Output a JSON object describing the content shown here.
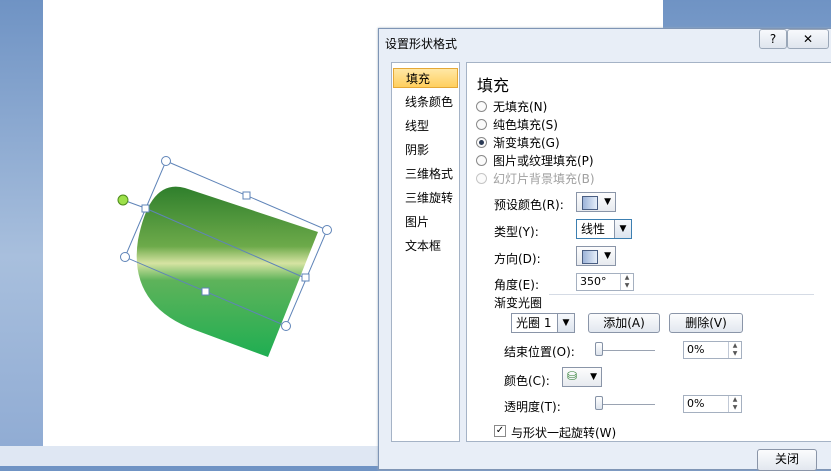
{
  "dialog": {
    "title": "设置形状格式",
    "help_label": "?",
    "close_label": "✕",
    "footer_close_label": "关闭"
  },
  "nav": {
    "items": [
      {
        "label": "填充",
        "active": true
      },
      {
        "label": "线条颜色"
      },
      {
        "label": "线型"
      },
      {
        "label": "阴影"
      },
      {
        "label": "三维格式"
      },
      {
        "label": "三维旋转"
      },
      {
        "label": "图片"
      },
      {
        "label": "文本框"
      }
    ]
  },
  "fill": {
    "title": "填充",
    "options": [
      {
        "label": "无填充(N)"
      },
      {
        "label": "纯色填充(S)"
      },
      {
        "label": "渐变填充(G)",
        "checked": true
      },
      {
        "label": "图片或纹理填充(P)"
      },
      {
        "label": "幻灯片背景填充(B)",
        "disabled": true
      }
    ],
    "preset_label": "预设颜色(R):",
    "type_label": "类型(Y):",
    "type_value": "线性",
    "direction_label": "方向(D):",
    "angle_label": "角度(E):",
    "angle_value": "350°",
    "stops_label": "渐变光圈",
    "stop_select_value": "光圈 1",
    "add_label": "添加(A)",
    "delete_label": "删除(V)",
    "end_position_label": "结束位置(O):",
    "end_position_value": "0%",
    "color_label": "颜色(C):",
    "transparency_label": "透明度(T):",
    "transparency_value": "0%",
    "rotate_with_shape_label": "与形状一起旋转(W)",
    "rotate_with_shape_checked": true
  },
  "icons": [
    "help-icon",
    "close-icon",
    "dropdown-arrow-icon",
    "paint-bucket-icon",
    "spin-up-icon",
    "spin-down-icon"
  ],
  "colors": {
    "shape_green_dark": "#1f8f3e",
    "shape_green_light": "#2dbb5b",
    "nav_active": "#ffcf5e",
    "dialog_bg": "#e8eef7"
  }
}
